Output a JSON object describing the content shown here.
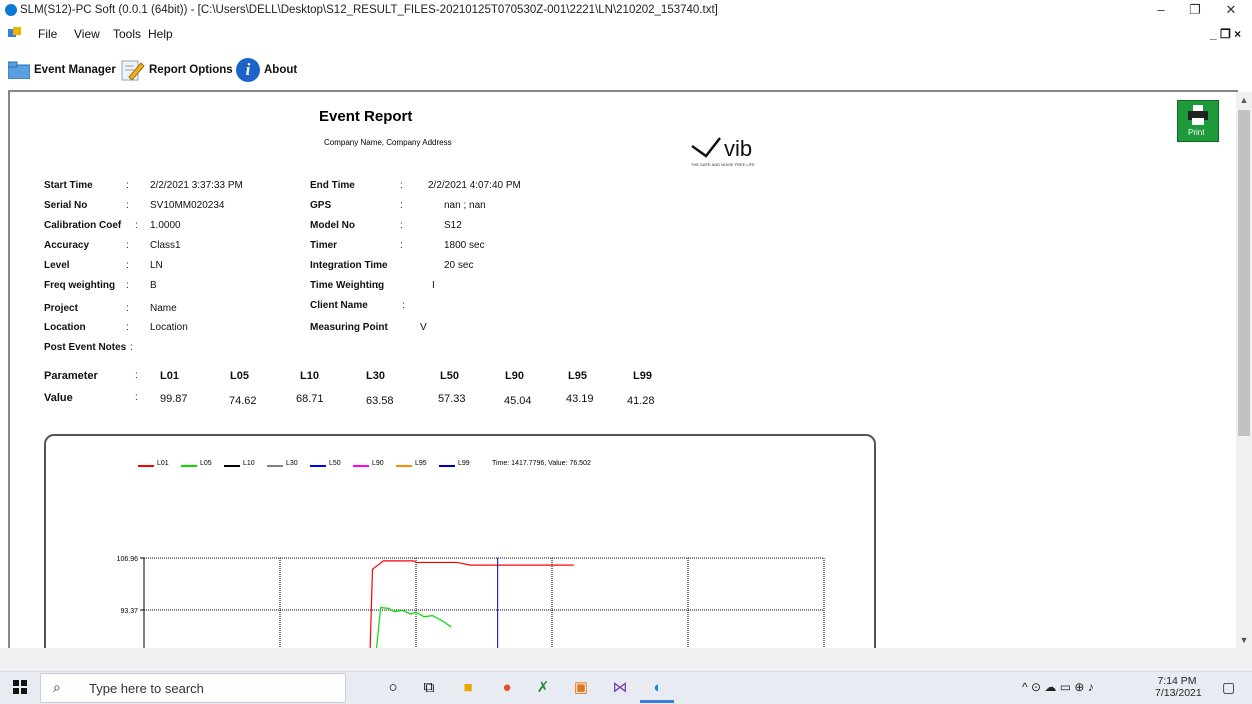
{
  "window": {
    "title": "SLM(S12)-PC Soft (0.0.1 (64bit)) - [C:\\Users\\DELL\\Desktop\\S12_RESULT_FILES-20210125T070530Z-001\\2221\\LN\\210202_153740.txt]",
    "minimize": "–",
    "maximize": "❐",
    "close": "✕",
    "mdi_controls": "_ ❐ ×"
  },
  "menu": {
    "file": "File",
    "view": "View",
    "tools": "Tools",
    "help": "Help"
  },
  "toolbar": {
    "event_manager": "Event Manager",
    "report_options": "Report Options",
    "about": "About"
  },
  "report": {
    "title": "Event Report",
    "company": "Company Name, Company Address",
    "logo_text": "vib",
    "logo_tagline": "THE SAFE AND NOISE FREE LIFE",
    "print_label": "Print",
    "colon": ":",
    "fields_left": [
      {
        "label": "Start Time",
        "value": "2/2/2021 3:37:33 PM"
      },
      {
        "label": "Serial No",
        "value": "SV10MM020234"
      },
      {
        "label": "Calibration Coef",
        "value": "1.0000"
      },
      {
        "label": "Accuracy",
        "value": "Class1"
      },
      {
        "label": "Level",
        "value": "LN"
      },
      {
        "label": "Freq weighting",
        "value": "B"
      },
      {
        "label": "Project",
        "value": "Name"
      },
      {
        "label": "Location",
        "value": "Location"
      },
      {
        "label": "Post Event Notes",
        "value": ""
      }
    ],
    "fields_right": [
      {
        "label": "End Time",
        "value": "2/2/2021 4:07:40 PM"
      },
      {
        "label": "GPS",
        "value": "nan ; nan"
      },
      {
        "label": "Model No",
        "value": "S12"
      },
      {
        "label": "Timer",
        "value": "1800 sec"
      },
      {
        "label": "Integration Time",
        "value": "20 sec"
      },
      {
        "label": "Time Weighting",
        "value": "I"
      },
      {
        "label": "Client Name",
        "value": ""
      },
      {
        "label": "Measuring Point",
        "value": "V"
      }
    ],
    "parameter_label": "Parameter",
    "value_label": "Value",
    "parameters": [
      "L01",
      "L05",
      "L10",
      "L30",
      "L50",
      "L90",
      "L95",
      "L99"
    ],
    "values": [
      "99.87",
      "74.62",
      "68.71",
      "63.58",
      "57.33",
      "45.04",
      "43.19",
      "41.28"
    ]
  },
  "chart_data": {
    "type": "line",
    "legend": [
      {
        "name": "L01",
        "color": "#ff0000"
      },
      {
        "name": "L05",
        "color": "#00dd00"
      },
      {
        "name": "L10",
        "color": "#000000"
      },
      {
        "name": "L30",
        "color": "#808080"
      },
      {
        "name": "L50",
        "color": "#0000ff"
      },
      {
        "name": "L90",
        "color": "#ff00ff"
      },
      {
        "name": "L95",
        "color": "#ff8c00"
      },
      {
        "name": "L99",
        "color": "#0000cc"
      }
    ],
    "cursor_readout": "Time: 1417.7796, Value: 76.502",
    "ytick_labels": [
      "106.96",
      "93.37"
    ],
    "grid": true,
    "series": [
      {
        "name": "L01",
        "color": "#ff0000",
        "points": [
          [
            0.83,
            80
          ],
          [
            0.84,
            104
          ],
          [
            0.88,
            106.2
          ],
          [
            0.99,
            106.2
          ],
          [
            1.0,
            105.8
          ],
          [
            1.15,
            105.8
          ],
          [
            1.2,
            105.1
          ],
          [
            1.58,
            105.1
          ]
        ]
      },
      {
        "name": "L05",
        "color": "#00dd00",
        "points": [
          [
            0.85,
            80
          ],
          [
            0.87,
            94
          ],
          [
            0.9,
            93.8
          ],
          [
            0.92,
            92.9
          ],
          [
            0.95,
            93.3
          ],
          [
            0.98,
            92.3
          ],
          [
            1.0,
            92.8
          ],
          [
            1.03,
            91.6
          ],
          [
            1.06,
            91.9
          ],
          [
            1.1,
            90.4
          ],
          [
            1.13,
            88.9
          ]
        ]
      }
    ],
    "cursor_time": 1.3
  },
  "taskbar": {
    "search_placeholder": "Type here to search",
    "time": "7:14 PM",
    "date": "7/13/2021"
  }
}
